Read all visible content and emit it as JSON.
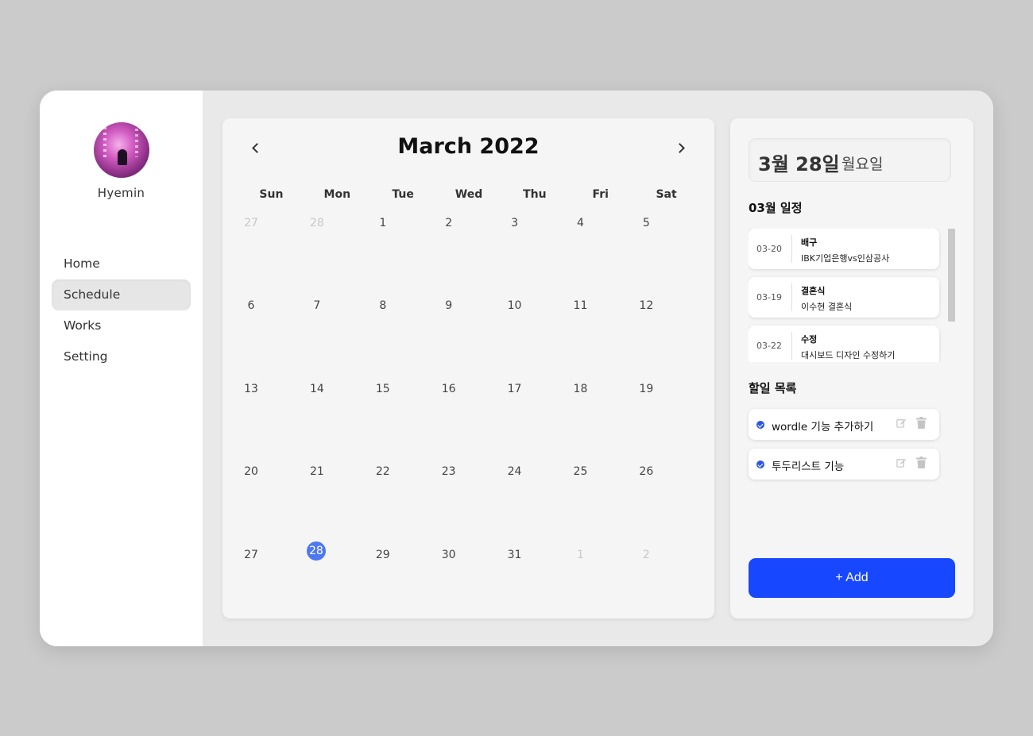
{
  "user": {
    "name": "Hyemin"
  },
  "nav": [
    {
      "label": "Home",
      "active": false
    },
    {
      "label": "Schedule",
      "active": true
    },
    {
      "label": "Works",
      "active": false
    },
    {
      "label": "Setting",
      "active": false
    }
  ],
  "calendar": {
    "title": "March 2022",
    "prev_icon": "chevron-left-icon",
    "next_icon": "chevron-right-icon",
    "weekdays": [
      "Sun",
      "Mon",
      "Tue",
      "Wed",
      "Thu",
      "Fri",
      "Sat"
    ],
    "days": [
      {
        "d": "27",
        "other": true
      },
      {
        "d": "28",
        "other": true
      },
      {
        "d": "1"
      },
      {
        "d": "2"
      },
      {
        "d": "3"
      },
      {
        "d": "4"
      },
      {
        "d": "5"
      },
      {
        "d": "6"
      },
      {
        "d": "7"
      },
      {
        "d": "8"
      },
      {
        "d": "9"
      },
      {
        "d": "10"
      },
      {
        "d": "11"
      },
      {
        "d": "12"
      },
      {
        "d": "13"
      },
      {
        "d": "14"
      },
      {
        "d": "15"
      },
      {
        "d": "16"
      },
      {
        "d": "17"
      },
      {
        "d": "18"
      },
      {
        "d": "19"
      },
      {
        "d": "20"
      },
      {
        "d": "21"
      },
      {
        "d": "22"
      },
      {
        "d": "23"
      },
      {
        "d": "24"
      },
      {
        "d": "25"
      },
      {
        "d": "26"
      },
      {
        "d": "27"
      },
      {
        "d": "28",
        "today": true
      },
      {
        "d": "29"
      },
      {
        "d": "30"
      },
      {
        "d": "31"
      },
      {
        "d": "1",
        "other": true
      },
      {
        "d": "2",
        "other": true
      }
    ]
  },
  "panel": {
    "date": "3월 28일",
    "weekday": "월요일",
    "schedule_title": "03월 일정",
    "events": [
      {
        "date": "03-20",
        "title": "배구",
        "desc": "IBK기업은행vs인삼공사"
      },
      {
        "date": "03-19",
        "title": "결혼식",
        "desc": "이수현 결혼식"
      },
      {
        "date": "03-22",
        "title": "수정",
        "desc": "대시보드 디자인 수정하기"
      }
    ],
    "todo_title": "할일 목록",
    "todos": [
      {
        "label": "wordle 기능 추가하기",
        "done": true
      },
      {
        "label": "투두리스트 기능",
        "done": true
      }
    ],
    "add_label": "+ Add"
  },
  "colors": {
    "accent": "#1747ff",
    "today": "#4e78f0",
    "check": "#2a55e6"
  }
}
